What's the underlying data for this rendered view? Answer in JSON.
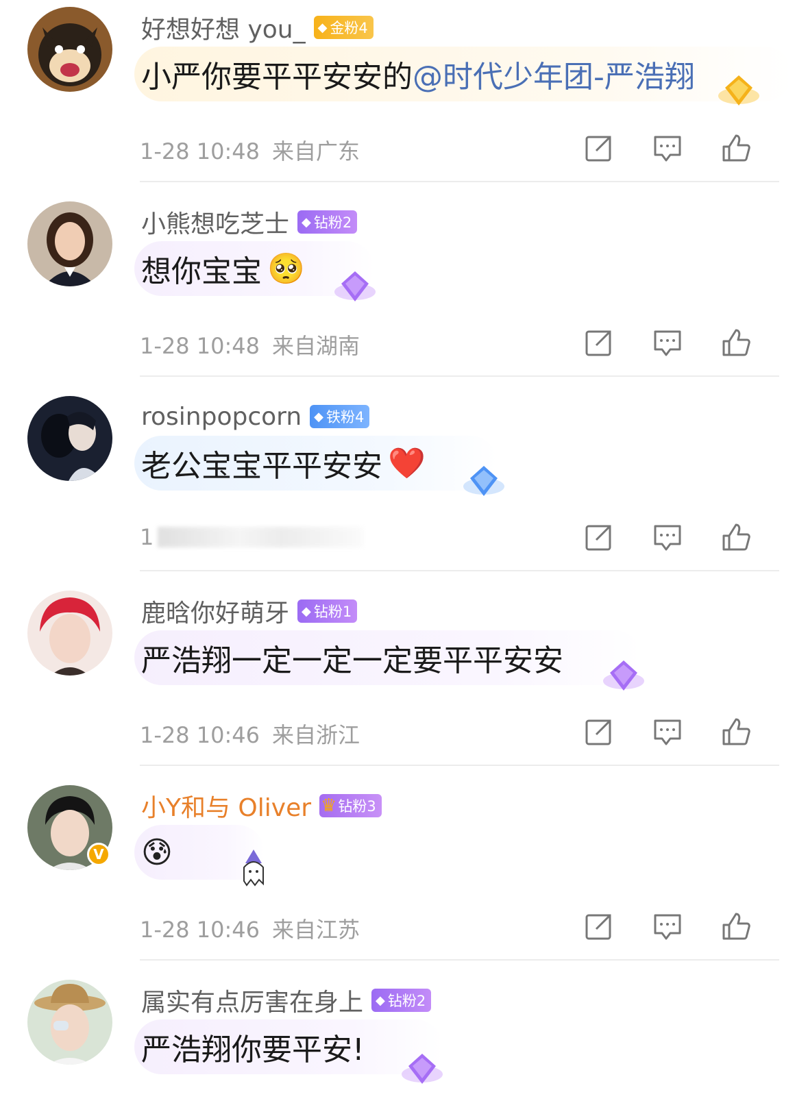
{
  "comments": [
    {
      "name": "好想好想 you_",
      "badge": "金粉4",
      "text": "小严你要平平安安的",
      "mention": "@时代少年团-严浩翔",
      "time": "1-28 10:48",
      "location": "来自广东"
    },
    {
      "name": "小熊想吃芝士",
      "badge": "钻粉2",
      "text": "想你宝宝",
      "emoji": "🥺",
      "time": "1-28 10:48",
      "location": "来自湖南"
    },
    {
      "name": "rosinpopcorn",
      "badge": "铁粉4",
      "text": "老公宝宝平平安安",
      "emoji": "❤️",
      "time_partial": "1"
    },
    {
      "name": "鹿晗你好萌牙",
      "badge": "钻粉1",
      "text": "严浩翔一定一定一定要平平安安",
      "time": "1-28 10:46",
      "location": "来自浙江"
    },
    {
      "name": "小Y和与 Oliver",
      "badge": "钻粉3",
      "emoji": "😰",
      "time": "1-28 10:46",
      "location": "来自江苏"
    },
    {
      "name": "属实有点厉害在身上",
      "badge": "钻粉2",
      "text": "严浩翔你要平安!"
    }
  ],
  "icons": {
    "share": "share-icon",
    "reply": "comment-icon",
    "like": "thumbs-up-icon",
    "verified": "verified-v-icon"
  },
  "colors": {
    "gold_badge": "#f7b21a",
    "diamond_badge": "#9b6bf3",
    "iron_badge": "#4e93f5",
    "vip_name": "#e8802a",
    "mention": "#4a6fb5",
    "meta": "#9e9e9e"
  }
}
